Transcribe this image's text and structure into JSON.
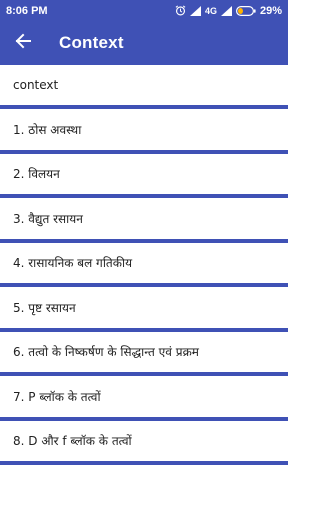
{
  "status_bar": {
    "time": "8:06 PM",
    "network": "4G",
    "battery": "29%",
    "icons": [
      "alarm-icon",
      "signal-icon",
      "network-signal-icon",
      "battery-icon"
    ]
  },
  "app_bar": {
    "title": "Context",
    "back_icon": "arrow-left-icon",
    "color": "#3f51b5"
  },
  "list": {
    "header": "context",
    "items": [
      {
        "label": "1. ठोस अवस्था"
      },
      {
        "label": "2. विलयन"
      },
      {
        "label": "3. वैद्युत रसायन"
      },
      {
        "label": "4. रासायनिक बल गतिकीय"
      },
      {
        "label": "5. पृष्ट रसायन"
      },
      {
        "label": "6. तत्वो के निष्कर्षण के सिद्धान्त एवं प्रक्रम"
      },
      {
        "label": "7. P ब्लॉक के तत्वों"
      },
      {
        "label": "8. D और f ब्लॉक के तत्वों"
      }
    ]
  }
}
